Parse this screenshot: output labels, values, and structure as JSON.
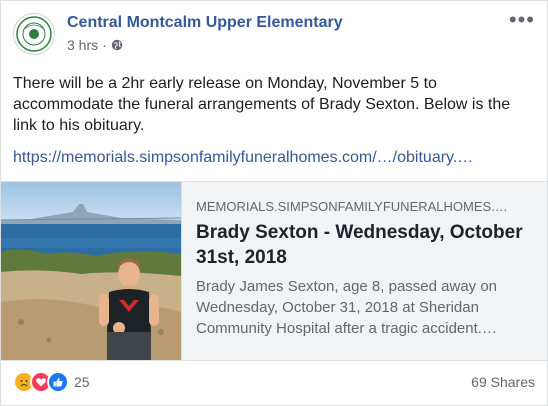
{
  "post": {
    "page_name": "Central Montcalm Upper Elementary",
    "time": "3 hrs",
    "separator": "·",
    "privacy_icon": "globe-icon",
    "more_icon": "more-dots-icon",
    "text": "There will be a 2hr early release on Monday, November 5 to accommodate the funeral arrangements of Brady Sexton. Below is the link to his obituary.",
    "link": "https://memorials.simpsonfamilyfuneralhomes.com/…/obituary.…"
  },
  "card": {
    "domain": "MEMORIALS.SIMPSONFAMILYFUNERALHOMES.…",
    "title": "Brady Sexton - Wednesday, October 31st, 2018",
    "description": "Brady James Sexton, age 8, passed away on Wednesday, October 31, 2018 at Sheridan Community Hospital after a tragic accident.…"
  },
  "footer": {
    "reaction_icons": [
      "sad-icon",
      "love-icon",
      "like-icon"
    ],
    "reaction_count": "25",
    "shares": "69 Shares"
  },
  "colors": {
    "link": "#385898",
    "page_name": "#365899",
    "card_bg": "#f2f3f5",
    "like": "#1877f2",
    "love": "#f33e58",
    "sad": "#f7b125"
  }
}
